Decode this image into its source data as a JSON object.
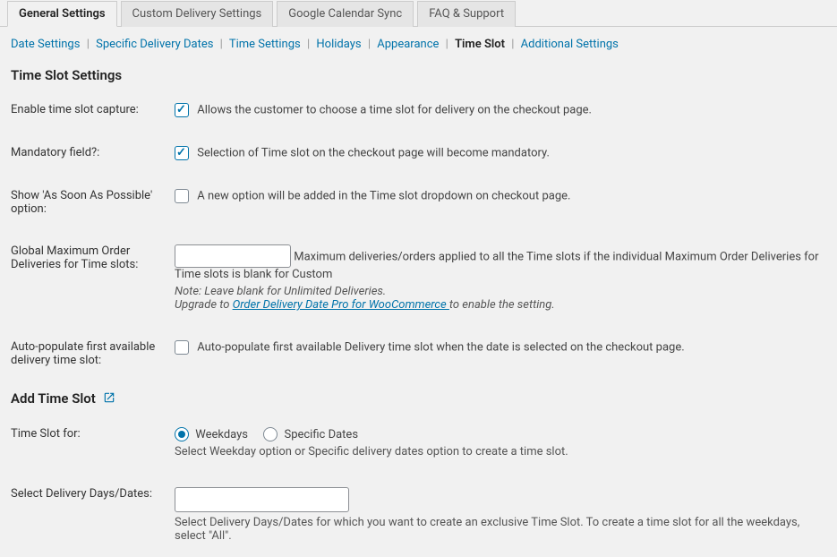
{
  "tabs": {
    "general": "General Settings",
    "custom": "Custom Delivery Settings",
    "google": "Google Calendar Sync",
    "faq": "FAQ & Support"
  },
  "subnav": {
    "date": "Date Settings",
    "specific": "Specific Delivery Dates",
    "time": "Time Settings",
    "holidays": "Holidays",
    "appearance": "Appearance",
    "timeslot": "Time Slot",
    "additional": "Additional Settings"
  },
  "sections": {
    "settings_title": "Time Slot Settings",
    "add_title": "Add Time Slot"
  },
  "fields": {
    "enable_capture": {
      "label": "Enable time slot capture:",
      "desc": "Allows the customer to choose a time slot for delivery on the checkout page."
    },
    "mandatory": {
      "label": "Mandatory field?:",
      "desc": "Selection of Time slot on the checkout page will become mandatory."
    },
    "asap": {
      "label": "Show 'As Soon As Possible' option:",
      "desc": "A new option will be added in the Time slot dropdown on checkout page."
    },
    "global_max": {
      "label": "Global Maximum Order Deliveries for Time slots:",
      "desc": "Maximum deliveries/orders applied to all the Time slots if the individual Maximum Order Deliveries for Time slots is blank for Custom",
      "note_prefix": "Note: Leave blank for Unlimited Deliveries.",
      "upgrade_prefix": "Upgrade to ",
      "upgrade_link": "Order Delivery Date Pro for WooCommerce ",
      "upgrade_suffix": "to enable the setting."
    },
    "auto_populate": {
      "label": "Auto-populate first available delivery time slot:",
      "desc": "Auto-populate first available Delivery time slot when the date is selected on the checkout page."
    },
    "timeslot_for": {
      "label": "Time Slot for:",
      "opt_weekdays": "Weekdays",
      "opt_specific": "Specific Dates",
      "desc": "Select Weekday option or Specific delivery dates option to create a time slot."
    },
    "select_days": {
      "label": "Select Delivery Days/Dates:",
      "desc": "Select Delivery Days/Dates for which you want to create an exclusive Time Slot. To create a time slot for all the weekdays, select \"All\"."
    }
  }
}
